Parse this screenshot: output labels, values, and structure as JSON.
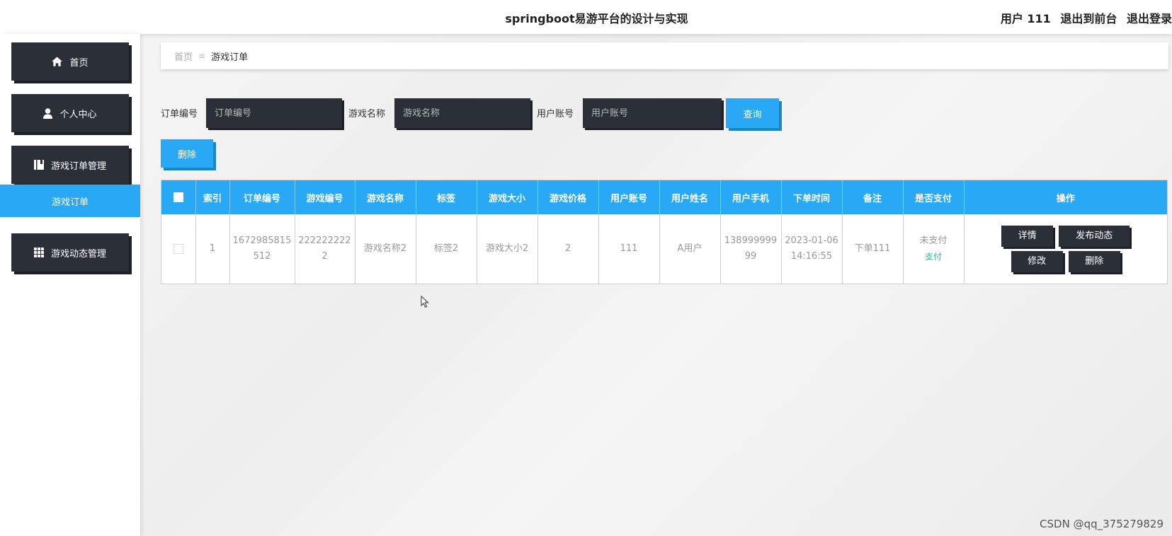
{
  "header": {
    "title": "springboot易游平台的设计与实现",
    "user_label": "用户 111",
    "back_to_front": "退出到前台",
    "logout": "退出登录"
  },
  "sidebar": {
    "items": [
      {
        "label": "首页",
        "icon": "home-icon"
      },
      {
        "label": "个人中心",
        "icon": "user-icon"
      },
      {
        "label": "游戏订单管理",
        "icon": "book-icon"
      },
      {
        "label": "游戏订单",
        "icon": ""
      },
      {
        "label": "游戏动态管理",
        "icon": "grid-icon"
      }
    ]
  },
  "breadcrumb": {
    "home": "首页",
    "separator": "≡",
    "current": "游戏订单"
  },
  "search": {
    "order_no_label": "订单编号",
    "order_no_placeholder": "订单编号",
    "game_name_label": "游戏名称",
    "game_name_placeholder": "游戏名称",
    "account_label": "用户账号",
    "account_placeholder": "用户账号",
    "query_button": "查询",
    "delete_button": "删除"
  },
  "table": {
    "headers": [
      "索引",
      "订单编号",
      "游戏编号",
      "游戏名称",
      "标签",
      "游戏大小",
      "游戏价格",
      "用户账号",
      "用户姓名",
      "用户手机",
      "下单时间",
      "备注",
      "是否支付",
      "操作"
    ],
    "rows": [
      {
        "index": "1",
        "order_no": "1672985815512",
        "game_no": "2222222222",
        "game_name": "游戏名称2",
        "tag": "标签2",
        "game_size": "游戏大小2",
        "price": "2",
        "account": "111",
        "user_name": "A用户",
        "phone": "13899999999",
        "order_time": "2023-01-06 14:16:55",
        "remark": "下单111",
        "paid_status": "未支付",
        "pay_link": "支付",
        "actions": {
          "detail": "详情",
          "publish": "发布动态",
          "edit": "修改",
          "delete": "删除"
        }
      }
    ]
  },
  "watermark": "CSDN @qq_375279829",
  "colors": {
    "accent": "#29a9f5",
    "dark": "#2b3038",
    "paid_green": "#1fbf8f"
  }
}
